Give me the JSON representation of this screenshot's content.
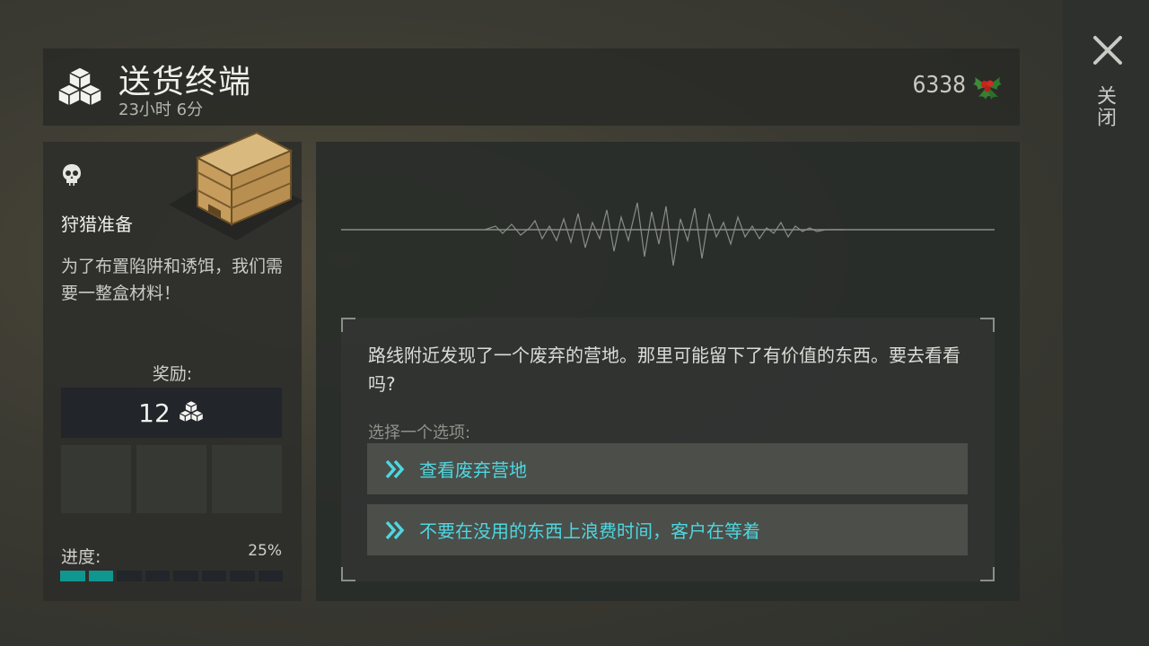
{
  "header": {
    "title": "送货终端",
    "timer": "23小时 6分",
    "currency_value": "6338",
    "currency_icon": "holly-icon"
  },
  "sidebar": {
    "close_label": "关闭",
    "close_icon": "close-icon"
  },
  "quest": {
    "icon": "skull-icon",
    "image": "wooden-crate",
    "name": "狩猎准备",
    "description": "为了布置陷阱和诱饵，我们需要一整盒材料！",
    "reward_label": "奖励:",
    "reward_value": "12",
    "reward_icon": "boxes-icon",
    "progress_label": "进度:",
    "progress_percent": "25%",
    "progress_fraction": 0.25,
    "progress_segments_total": 8,
    "progress_segments_filled": 2
  },
  "event": {
    "story_text": "路线附近发现了一个废弃的营地。那里可能留下了有价值的东西。要去看看吗?",
    "choose_label": "选择一个选项:",
    "options": [
      {
        "label": "查看废弃营地"
      },
      {
        "label": "不要在没用的东西上浪费时间，客户在等着"
      }
    ]
  },
  "colors": {
    "accent_cyan": "#4fd6e0",
    "progress_teal": "#109690"
  }
}
